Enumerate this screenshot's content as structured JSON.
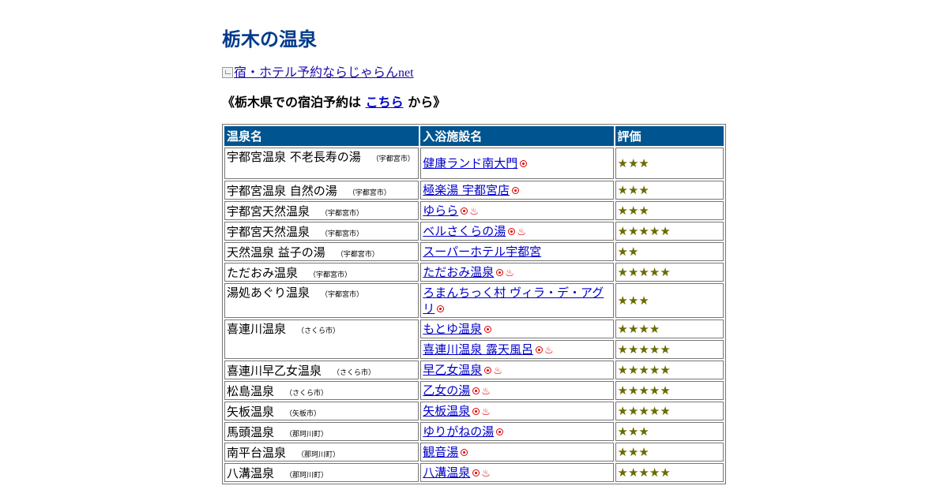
{
  "page": {
    "title": "栃木の温泉",
    "banner_alt": "宿・ホテル予約ならじゃらんnet",
    "reserve_prefix": "《栃木県での宿泊予約は",
    "reserve_link": "こちら",
    "reserve_suffix": "から》"
  },
  "table": {
    "headers": [
      "温泉名",
      "入浴施設名",
      "評価"
    ],
    "rows": [
      {
        "onsen": "宇都宮温泉 不老長寿の湯",
        "city": "（宇都宮市）",
        "facility": "健康ランド南大門",
        "day": true,
        "spa": false,
        "rating": "★★★",
        "tall": true
      },
      {
        "onsen": "宇都宮温泉 自然の湯",
        "city": "（宇都宮市）",
        "facility": "極楽湯 宇都宮店",
        "day": true,
        "spa": false,
        "rating": "★★★"
      },
      {
        "onsen": "宇都宮天然温泉",
        "city": "（宇都宮市）",
        "facility": "ゆらら",
        "day": true,
        "spa": true,
        "rating": "★★★"
      },
      {
        "onsen": "宇都宮天然温泉",
        "city": "（宇都宮市）",
        "facility": "ベルさくらの湯",
        "day": true,
        "spa": true,
        "rating": "★★★★★"
      },
      {
        "onsen": "天然温泉 益子の湯",
        "city": "（宇都宮市）",
        "facility": "スーパーホテル宇都宮",
        "day": false,
        "spa": false,
        "rating": "★★"
      },
      {
        "onsen": "ただおみ温泉",
        "city": "（宇都宮市）",
        "facility": "ただおみ温泉",
        "day": true,
        "spa": true,
        "rating": "★★★★★"
      },
      {
        "onsen": "湯処あぐり温泉",
        "city": "（宇都宮市）",
        "facility": "ろまんちっく村 ヴィラ・デ・アグリ",
        "day": true,
        "spa": false,
        "rating": "★★★",
        "tall": true
      },
      {
        "onsen": "喜連川温泉",
        "city": "（さくら市）",
        "facility": "もとゆ温泉",
        "day": true,
        "spa": false,
        "rating": "★★★★",
        "rowspan": 2
      },
      {
        "onsen": "",
        "city": "",
        "facility": "喜連川温泉 露天風呂",
        "day": true,
        "spa": true,
        "rating": "★★★★★",
        "merged": true
      },
      {
        "onsen": "喜連川早乙女温泉",
        "city": "（さくら市）",
        "facility": "早乙女温泉",
        "day": true,
        "spa": true,
        "rating": "★★★★★"
      },
      {
        "onsen": "松島温泉",
        "city": "（さくら市）",
        "facility": "乙女の湯",
        "day": true,
        "spa": true,
        "rating": "★★★★★"
      },
      {
        "onsen": "矢板温泉",
        "city": "（矢板市）",
        "facility": "矢板温泉",
        "day": true,
        "spa": true,
        "rating": "★★★★★"
      },
      {
        "onsen": "馬頭温泉",
        "city": "（那珂川町）",
        "facility": "ゆりがねの湯",
        "day": true,
        "spa": false,
        "rating": "★★★"
      },
      {
        "onsen": "南平台温泉",
        "city": "（那珂川町）",
        "facility": "観音湯",
        "day": true,
        "spa": false,
        "rating": "★★★"
      },
      {
        "onsen": "八溝温泉",
        "city": "（那珂川町）",
        "facility": "八溝温泉",
        "day": true,
        "spa": true,
        "rating": "★★★★★"
      }
    ]
  },
  "icons": {
    "day": "day-use-icon",
    "spa": "hot-spring-icon",
    "spa_glyph": "♨"
  },
  "colors": {
    "title": "#003a8c",
    "header_bg": "#00548f",
    "link": "#0000cc",
    "rating": "#6b6b00",
    "icon": "#dd0000"
  }
}
